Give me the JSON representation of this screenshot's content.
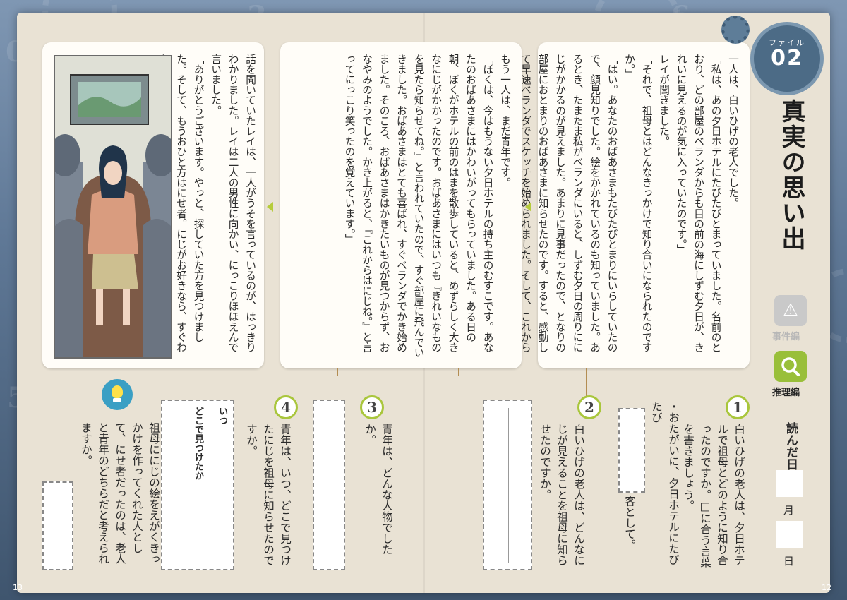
{
  "file_badge": {
    "label": "ファイル",
    "number": "02"
  },
  "title": "真実の思い出",
  "tabs": {
    "case": "事件編",
    "reasoning": "推理編"
  },
  "date": {
    "label": "読んだ日",
    "month": "月",
    "day": "日"
  },
  "story": {
    "panel1": [
      "一人は、白いひげの老人でした。",
      "「私は、あの夕日ホテルにたびたびとまっていました。名前のとおり、どの部屋のベランダからも目の前の海にしずむ夕日が、きれいに見えるのが気に入っていたのです。」",
      "レイが聞きました。",
      "「それで、祖母とはどんなきっかけで知り合いになられたのですか。」",
      "「はい。あなたのおばあさまもたびたびとまりにいらしていたので、顔見知りでした。絵をかかれているのも知っていました。あるとき、たまたま私がベランダにいると、しずむ夕日の周りににじがかかるのが見えました。あまりに見事だったので、となりの部屋におとまりのおばあさまに知らせたのです。すると、感動して早速ベランダでスケッチを始められました。そして、これからもにじをかき続けると喜んで話してくださったのです。」"
    ],
    "panel2": [
      "もう一人は、まだ青年です。",
      "「ぼくは、今はもうない夕日ホテルの持ち主のむすこです。あなたのおばあさまにはかわいがってもらっていました。ある日の朝、ぼくがホテルの前のはまを散歩していると、めずらしく大きなにじがかかったのです。おばあさまにはいつも『きれいなものを見たら知らせてね。』と言われていたので、すぐ部屋に飛んでいきました。おばあさまはとても喜ばれ、すぐベランダでかき始めました。そのころ、おばあさまはかきたいものが見つからず、おなやみのようでした。かき上がると、『これからはにじね。』と言ってにっこり笑ったのを覚えています。」"
    ],
    "panel3": [
      "話を聞いていたレイは、一人がうそを言っているのが、はっきりわかりました。レイは二人の男性に向かい、にっこりほほえんで言いました。",
      "「ありがとうございます。やっと、探していた方を見つけました。そして、もうおひと方はにせ者。にじがお好きなら、すぐわかりますわ。さあ、にせ者は、どちらでしょう。」"
    ]
  },
  "questions": {
    "q1": {
      "num": "1",
      "text": "白いひげの老人は、夕日ホテルで祖母とどのように知り合ったのですか。□に合う言葉を書きましょう。"
    },
    "q1_fill": {
      "prefix": "・おたがいに、夕日ホテルにたびたび",
      "suffix": "客として。"
    },
    "q2": {
      "num": "2",
      "text": "白いひげの老人は、どんなにじが見えることを祖母に知らせたのですか。"
    },
    "q3": {
      "num": "3",
      "text": "青年は、どんな人物でしたか。"
    },
    "q4": {
      "num": "4",
      "text": "青年は、いつ、どこで見つけたにじを祖母に知らせたのですか。"
    },
    "q4_sub": {
      "a": "いつ",
      "b": "どこで見つけたか"
    },
    "q5": {
      "text": "祖母ににじの絵をえがくきっかけを作ってくれた人として、にせ者だったのは、老人と青年のどちらだと考えられますか。"
    }
  },
  "page_numbers": {
    "left": "13",
    "right": "12"
  },
  "colors": {
    "accent_green": "#99bf3a",
    "badge_blue": "#4c6b86",
    "background_blue": "#5f7896"
  },
  "icons": [
    "warning-icon",
    "magnifier-icon",
    "lightbulb-icon",
    "gear-icon"
  ]
}
